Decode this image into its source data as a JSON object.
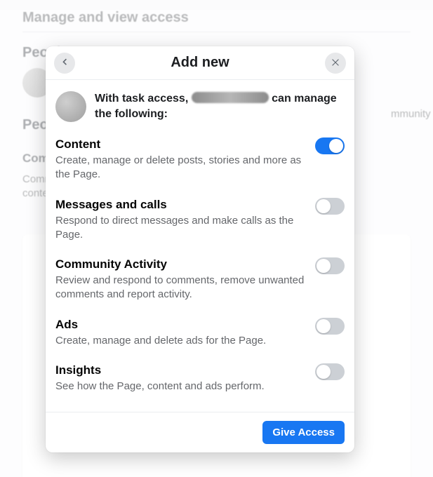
{
  "background": {
    "page_title": "Manage and view access",
    "section_people": "People",
    "section_people_2": "People",
    "item_title": "Community",
    "item_desc": "Community Activity, remove unwanted content and report activity on this Page.",
    "right_tail": "mmunity Activity,"
  },
  "modal": {
    "title": "Add new",
    "intro_before": "With task access, ",
    "intro_after": " can manage the following:",
    "cta": "Give Access",
    "permissions": [
      {
        "key": "content",
        "title": "Content",
        "desc": "Create, manage or delete posts, stories and more as the Page.",
        "on": true
      },
      {
        "key": "messages",
        "title": "Messages and calls",
        "desc": "Respond to direct messages and make calls as the Page.",
        "on": false
      },
      {
        "key": "community",
        "title": "Community Activity",
        "desc": "Review and respond to comments, remove unwanted comments and report activity.",
        "on": false
      },
      {
        "key": "ads",
        "title": "Ads",
        "desc": "Create, manage and delete ads for the Page.",
        "on": false
      },
      {
        "key": "insights",
        "title": "Insights",
        "desc": "See how the Page, content and ads perform.",
        "on": false
      }
    ]
  }
}
